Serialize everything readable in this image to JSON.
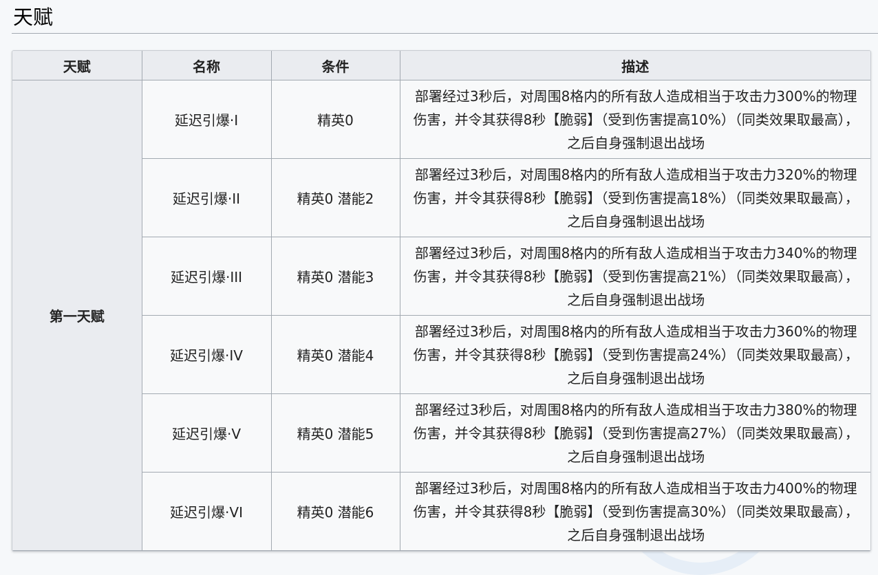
{
  "section": {
    "title": "天赋"
  },
  "table": {
    "headers": [
      "天赋",
      "名称",
      "条件",
      "描述"
    ],
    "group_label": "第一天赋",
    "rows": [
      {
        "name": "延迟引爆·I",
        "condition": "精英0",
        "description": "部署经过3秒后，对周围8格内的所有敌人造成相当于攻击力300%的物理伤害，并令其获得8秒【脆弱】（受到伤害提高10%）（同类效果取最高），之后自身强制退出战场"
      },
      {
        "name": "延迟引爆·II",
        "condition": "精英0 潜能2",
        "description": "部署经过3秒后，对周围8格内的所有敌人造成相当于攻击力320%的物理伤害，并令其获得8秒【脆弱】（受到伤害提高18%）（同类效果取最高），之后自身强制退出战场"
      },
      {
        "name": "延迟引爆·III",
        "condition": "精英0 潜能3",
        "description": "部署经过3秒后，对周围8格内的所有敌人造成相当于攻击力340%的物理伤害，并令其获得8秒【脆弱】（受到伤害提高21%）（同类效果取最高），之后自身强制退出战场"
      },
      {
        "name": "延迟引爆·IV",
        "condition": "精英0 潜能4",
        "description": "部署经过3秒后，对周围8格内的所有敌人造成相当于攻击力360%的物理伤害，并令其获得8秒【脆弱】（受到伤害提高24%）（同类效果取最高），之后自身强制退出战场"
      },
      {
        "name": "延迟引爆·V",
        "condition": "精英0 潜能5",
        "description": "部署经过3秒后，对周围8格内的所有敌人造成相当于攻击力380%的物理伤害，并令其获得8秒【脆弱】（受到伤害提高27%）（同类效果取最高），之后自身强制退出战场"
      },
      {
        "name": "延迟引爆·VI",
        "condition": "精英0 潜能6",
        "description": "部署经过3秒后，对周围8格内的所有敌人造成相当于攻击力400%的物理伤害，并令其获得8秒【脆弱】（受到伤害提高30%）（同类效果取最高），之后自身强制退出战场"
      }
    ]
  }
}
